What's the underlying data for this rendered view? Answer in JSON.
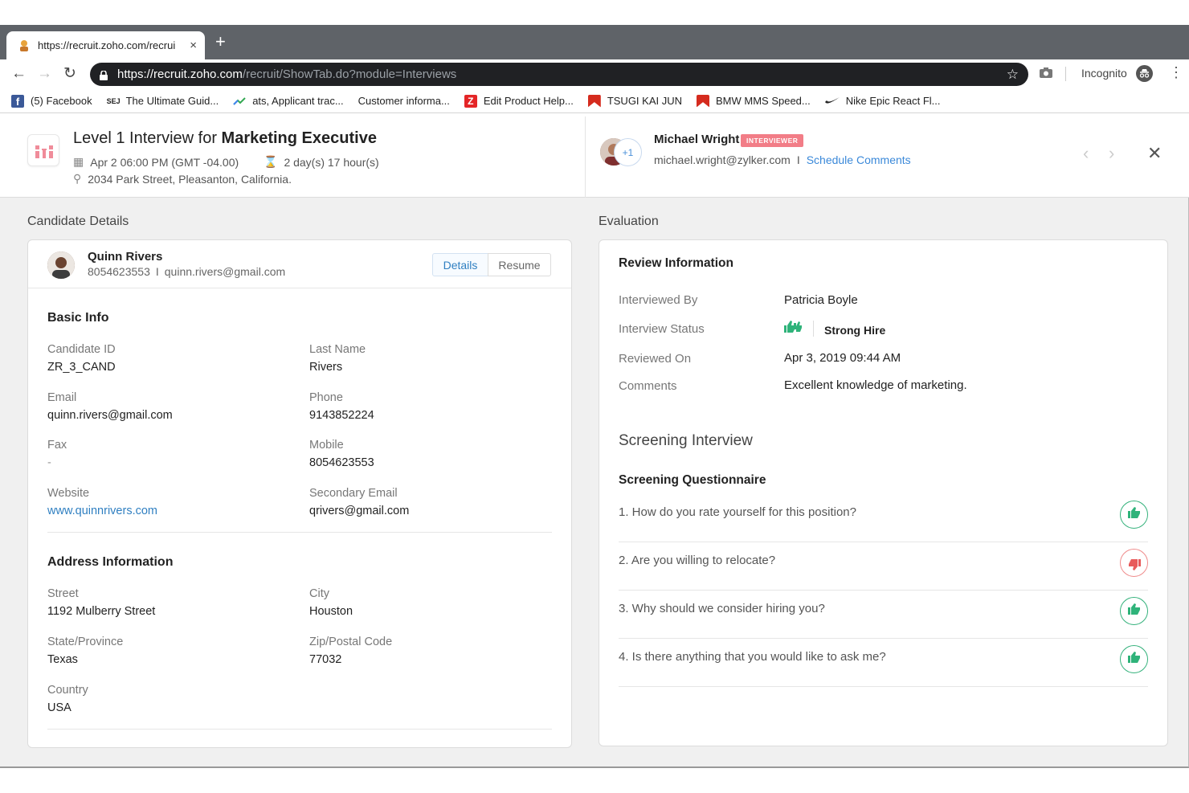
{
  "browser": {
    "tab_title": "https://recruit.zoho.com/recrui",
    "new_tab": "+",
    "close_tab": "×",
    "url_host": "https://recruit.zoho.com",
    "url_path": "/recruit/ShowTab.do?module=Interviews",
    "incognito_label": "Incognito",
    "bookmarks": [
      {
        "label": "(5) Facebook",
        "icon": "facebook-icon",
        "color": "#3b5998"
      },
      {
        "label": "The Ultimate Guid...",
        "icon": "sej-icon",
        "color": "#222222"
      },
      {
        "label": "ats, Applicant trac...",
        "icon": "trend-icon",
        "color": "#4285f4"
      },
      {
        "label": "Customer informa...",
        "icon": "blank-icon",
        "color": "#ffffff"
      },
      {
        "label": "Edit Product Help...",
        "icon": "zoho-icon",
        "color": "#e42527"
      },
      {
        "label": "TSUGI KAI JUN",
        "icon": "red-flag-icon",
        "color": "#d52b1e"
      },
      {
        "label": "BMW MMS Speed...",
        "icon": "red-flag-icon",
        "color": "#d52b1e"
      },
      {
        "label": "Nike Epic React Fl...",
        "icon": "nike-swoosh-icon",
        "color": "#222222"
      }
    ]
  },
  "interview": {
    "title_prefix": "Level 1 Interview for ",
    "title_role": "Marketing Executive",
    "datetime": "Apr 2 06:00 PM (GMT -04.00)",
    "duration": "2 day(s) 17 hour(s)",
    "location": "2034 Park Street, Pleasanton, California.",
    "interviewer_name": "Michael Wright",
    "interviewer_badge": "INTERVIEWER",
    "interviewer_email": "michael.wright@zylker.com",
    "pipe": "I",
    "schedule_comments": "Schedule Comments",
    "plus_count": "+1"
  },
  "candidate": {
    "section_title": "Candidate Details",
    "name": "Quinn Rivers",
    "phone": "8054623553",
    "email": "quinn.rivers@gmail.com",
    "tab_details": "Details",
    "tab_resume": "Resume",
    "basic_info_title": "Basic Info",
    "fields": {
      "candidate_id_label": "Candidate ID",
      "candidate_id": "ZR_3_CAND",
      "last_name_label": "Last Name",
      "last_name": "Rivers",
      "email_label": "Email",
      "email": "quinn.rivers@gmail.com",
      "phone_label": "Phone",
      "phone": "9143852224",
      "fax_label": "Fax",
      "fax": "-",
      "mobile_label": "Mobile",
      "mobile": "8054623553",
      "website_label": "Website",
      "website": "www.quinnrivers.com",
      "secondary_email_label": "Secondary Email",
      "secondary_email": "qrivers@gmail.com"
    },
    "address_title": "Address Information",
    "address": {
      "street_label": "Street",
      "street": "1192 Mulberry Street",
      "city_label": "City",
      "city": "Houston",
      "state_label": "State/Province",
      "state": "Texas",
      "zip_label": "Zip/Postal Code",
      "zip": "77032",
      "country_label": "Country",
      "country": "USA"
    }
  },
  "evaluation": {
    "section_title": "Evaluation",
    "review_title": "Review Information",
    "interviewed_by_label": "Interviewed By",
    "interviewed_by": "Patricia Boyle",
    "status_label": "Interview Status",
    "status": "Strong Hire",
    "reviewed_on_label": "Reviewed On",
    "reviewed_on": "Apr 3, 2019 09:44 AM",
    "comments_label": "Comments",
    "comments": "Excellent knowledge of marketing.",
    "screening_title": "Screening Interview",
    "questionnaire_title": "Screening Questionnaire",
    "questions": [
      {
        "text": "1.  How do you rate yourself for this position?",
        "rating": "thumbs-up"
      },
      {
        "text": "2.  Are you willing to relocate?",
        "rating": "thumbs-down"
      },
      {
        "text": "3.  Why should we consider hiring you?",
        "rating": "thumbs-up"
      },
      {
        "text": "4.  Is there anything that you would like to ask me?",
        "rating": "thumbs-up"
      }
    ],
    "colors": {
      "positive": "#2fb37a",
      "negative": "#e85b5b"
    }
  }
}
